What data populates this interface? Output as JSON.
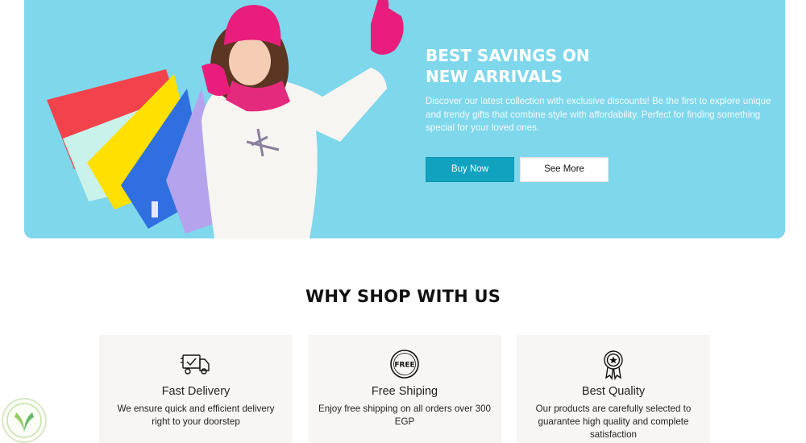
{
  "hero": {
    "title_line1": "BEST SAVINGS ON",
    "title_line2": "NEW ARRIVALS",
    "description": "Discover our latest collection with exclusive discounts! Be the first to explore unique and trendy gifts that combine style with affordability. Perfect for finding something special for your loved ones.",
    "buy_label": "Buy Now",
    "see_more_label": "See More",
    "background_color": "#7fd7eb",
    "buy_button_color": "#11a2c0"
  },
  "why": {
    "title": "WHY SHOP WITH US",
    "features": [
      {
        "icon": "delivery-truck-icon",
        "title": "Fast Delivery",
        "desc": "We ensure quick and efficient delivery right to your doorstep"
      },
      {
        "icon": "free-badge-icon",
        "title": "Free Shiping",
        "desc": "Enjoy free shipping on all orders over 300 EGP"
      },
      {
        "icon": "award-ribbon-icon",
        "title": "Best Quality",
        "desc": "Our products are carefully selected to guarantee high quality and complete satisfaction"
      }
    ]
  },
  "free_icon_text": "FREE"
}
